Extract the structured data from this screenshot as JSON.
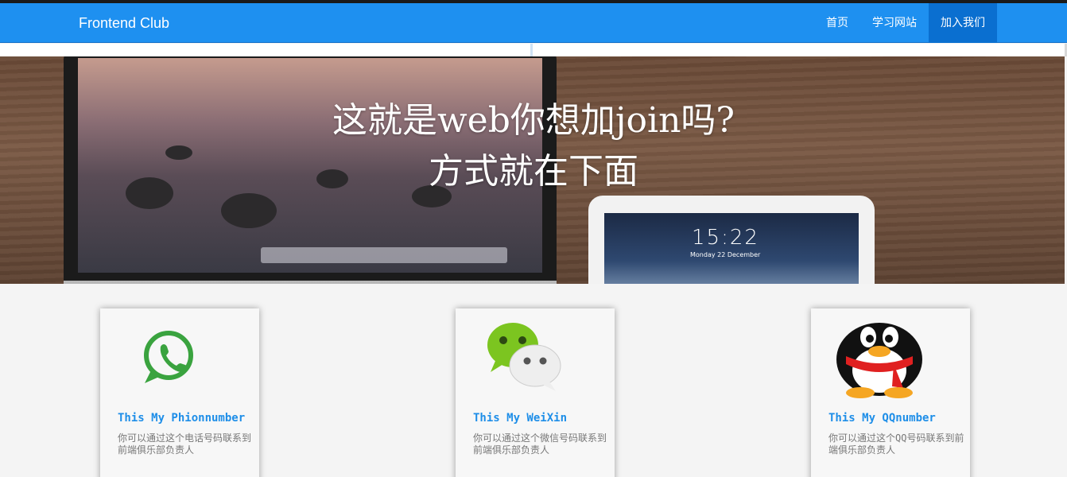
{
  "brand": "Frontend Club",
  "nav": {
    "items": [
      {
        "label": "首页"
      },
      {
        "label": "学习网站"
      },
      {
        "label": "加入我们"
      }
    ]
  },
  "hero": {
    "line1": "这就是web你想加join吗?",
    "line2": "方式就在下面",
    "tablet_clock": "15:22",
    "tablet_date": "Monday 22 December"
  },
  "cards": [
    {
      "title": "This My Phionnumber",
      "desc": "你可以通过这个电话号码联系到前端俱乐部负责人",
      "icon": "whatsapp-icon"
    },
    {
      "title": "This My WeiXin",
      "desc": "你可以通过这个微信号码联系到前端俱乐部负责人",
      "icon": "wechat-icon"
    },
    {
      "title": "This My QQnumber",
      "desc": "你可以通过这个QQ号码联系到前端俱乐部负责人",
      "icon": "qq-penguin-icon"
    }
  ],
  "colors": {
    "nav": "#1e90f0",
    "active_nav": "#0a6fd0",
    "card_title": "#1e8ee8"
  }
}
